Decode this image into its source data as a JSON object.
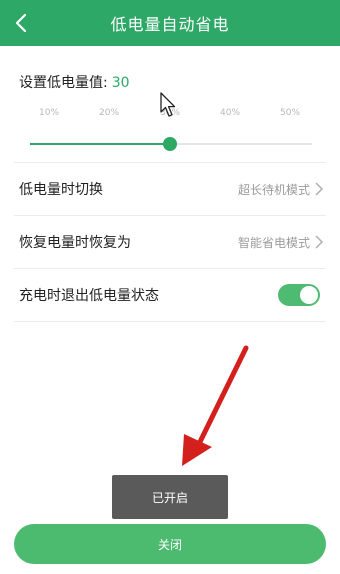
{
  "header": {
    "title": "低电量自动省电",
    "back_icon": "chevron-left-icon"
  },
  "threshold": {
    "label": "设置低电量值:",
    "value": "30",
    "slider_level_percent": 30
  },
  "ticks": [
    "10%",
    "20%",
    "30%",
    "40%",
    "50%"
  ],
  "settings": [
    {
      "label": "低电量时切换",
      "value": "超长待机模式"
    },
    {
      "label": "恢复电量时恢复为",
      "value": "智能省电模式"
    }
  ],
  "charge_toggle": {
    "label": "充电时退出低电量状态",
    "on": true
  },
  "toast": "已开启",
  "close_button": "关闭",
  "colors": {
    "accent": "#2ea866",
    "toggle": "#4fbb72",
    "button": "#4cbb70",
    "arrow": "#d4201c"
  }
}
